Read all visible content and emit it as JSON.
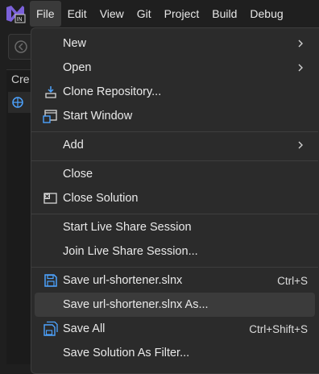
{
  "menubar": {
    "items": [
      {
        "label": "File"
      },
      {
        "label": "Edit"
      },
      {
        "label": "View"
      },
      {
        "label": "Git"
      },
      {
        "label": "Project"
      },
      {
        "label": "Build"
      },
      {
        "label": "Debug"
      }
    ]
  },
  "background": {
    "tab_label": "Cre"
  },
  "file_menu": {
    "items": [
      {
        "label": "New",
        "submenu": true
      },
      {
        "label": "Open",
        "submenu": true
      },
      {
        "label": "Clone Repository...",
        "icon": "clone-repository-icon"
      },
      {
        "label": "Start Window",
        "icon": "start-window-icon"
      },
      {
        "label": "Add",
        "submenu": true
      },
      {
        "label": "Close"
      },
      {
        "label": "Close Solution",
        "icon": "close-solution-icon"
      },
      {
        "label": "Start Live Share Session"
      },
      {
        "label": "Join Live Share Session..."
      },
      {
        "label": "Save url-shortener.slnx",
        "shortcut": "Ctrl+S",
        "icon": "save-icon"
      },
      {
        "label": "Save url-shortener.slnx As...",
        "highlighted": true
      },
      {
        "label": "Save All",
        "shortcut": "Ctrl+Shift+S",
        "icon": "save-all-icon"
      },
      {
        "label": "Save Solution As Filter..."
      }
    ]
  },
  "colors": {
    "accent": "#7b61d9",
    "menu_bg": "#2b2b2b",
    "highlight": "#3b3b3b",
    "icon_blue": "#4da3ff"
  }
}
